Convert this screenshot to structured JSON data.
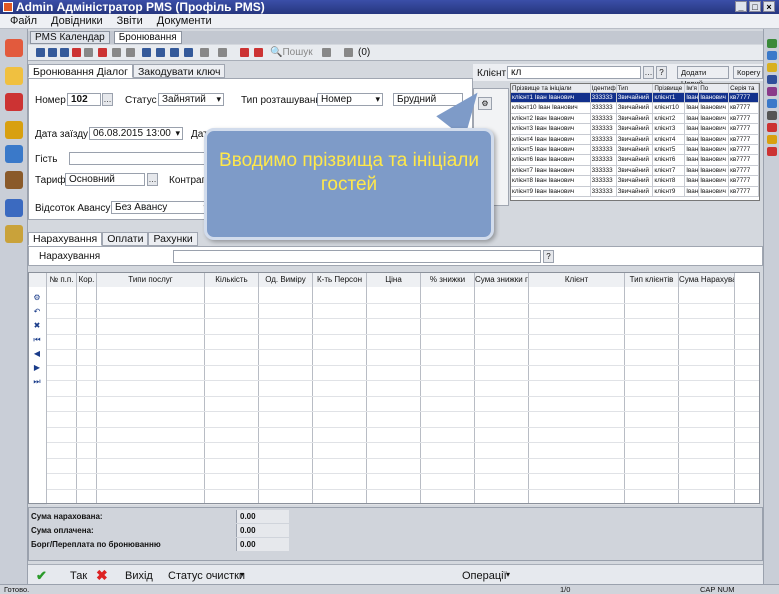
{
  "window": {
    "title": "Admin Адміністратор PMS (Профіль PMS)",
    "controls": [
      "_",
      "□",
      "×"
    ]
  },
  "menu": [
    "Файл",
    "Довідники",
    "Звіти",
    "Документи"
  ],
  "doc_tabs": [
    "PMS Календар",
    "Бронювання"
  ],
  "toolbar": {
    "search_label": "Пошук",
    "indicator": "(0)"
  },
  "dialog_tabs": [
    "Бронювання Діалог",
    "Закодувати ключ"
  ],
  "form": {
    "room_label": "Номер",
    "room_value": "102",
    "status_label": "Статус",
    "status_value": "Зайнятий",
    "placement_label": "Тип розташування",
    "placement_value": "Номер",
    "placement_value2": "Брудний",
    "checkin_label": "Дата заїзду",
    "checkin_value": "06.08.2015 13:00",
    "checkout_label": "Дат",
    "guest_label": "Гість",
    "tariff_label": "Тариф",
    "tariff_value": "Основний",
    "contragent_label": "Контраге",
    "advance_label": "Відсоток Авансу",
    "advance_value": "Без Авансу"
  },
  "client_search": {
    "label": "Клієнт:",
    "value": "кл",
    "add_button": "Додати Новий",
    "edit_button": "Корегу",
    "headers": [
      "Прізвище та ініціали",
      "Ідентиф",
      "Тип",
      "Прізвище",
      "Ім'я",
      "По",
      "Серія та"
    ],
    "rows": [
      [
        "клієнт1 Іван Іванович",
        "333333",
        "Звичайний",
        "клієнт1",
        "Іван",
        "Іванович",
        "кв7777"
      ],
      [
        "клієнт10 Іван Іванович",
        "333333",
        "Звичайний",
        "клієнт10",
        "Іван",
        "Іванович",
        "кв7777"
      ],
      [
        "клієнт2 Іван Іванович",
        "333333",
        "Звичайний",
        "клієнт2",
        "Іван",
        "Іванович",
        "кв7777"
      ],
      [
        "клієнт3 Іван Іванович",
        "333333",
        "Звичайний",
        "клієнт3",
        "Іван",
        "Іванович",
        "кв7777"
      ],
      [
        "клієнт4 Іван Іванович",
        "333333",
        "Звичайний",
        "клієнт4",
        "Іван",
        "Іванович",
        "кв7777"
      ],
      [
        "клієнт5 Іван Іванович",
        "333333",
        "Звичайний",
        "клієнт5",
        "Іван",
        "Іванович",
        "кв7777"
      ],
      [
        "клієнт6 Іван Іванович",
        "333333",
        "Звичайний",
        "клієнт6",
        "Іван",
        "Іванович",
        "кв7777"
      ],
      [
        "клієнт7 Іван Іванович",
        "333333",
        "Звичайний",
        "клієнт7",
        "Іван",
        "Іванович",
        "кв7777"
      ],
      [
        "клієнт8 Іван Іванович",
        "333333",
        "Звичайний",
        "клієнт8",
        "Іван",
        "Іванович",
        "кв7777"
      ],
      [
        "клієнт9 Іван Іванович",
        "333333",
        "Звичайний",
        "клієнт9",
        "Іван",
        "Іванович",
        "кв7777"
      ]
    ]
  },
  "tooltip": "Вводимо прізвища та ініціали гостей",
  "lower_tabs": [
    "Нарахування",
    "Оплати",
    "Рахунки"
  ],
  "accruals_label": "Нарахування",
  "grid_headers": [
    "№ п.п.",
    "Кор.",
    "Типи послуг",
    "Кількість",
    "Од. Виміру",
    "К-ть Персон",
    "Ціна",
    "% знижки",
    "Сума знижки грн",
    "Клієнт",
    "Тип клієнтів",
    "Сума Нарахування"
  ],
  "totals": [
    {
      "label": "Сума нарахована:",
      "value": "0.00"
    },
    {
      "label": "Сума оплачена:",
      "value": "0.00"
    },
    {
      "label": "Борг/Переплата по бронюванню",
      "value": "0.00"
    }
  ],
  "bottom": {
    "ok": "Так",
    "exit": "Вихід",
    "cleaning": "Статус очистки",
    "operations": "Операції"
  },
  "statusbar": {
    "left": "Готово.",
    "page": "1/0",
    "flags": "CAP  NUM"
  },
  "colors": {
    "title_bar": "#2e3f90",
    "selected_row": "#12308c",
    "tooltip_bg": "#7e9bc8",
    "tooltip_text": "#ffe84a"
  }
}
